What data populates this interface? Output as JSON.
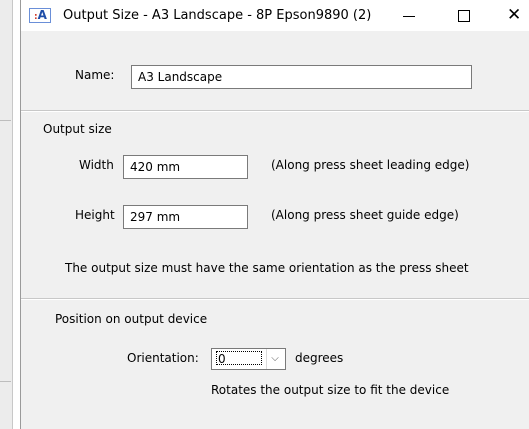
{
  "window": {
    "title": "Output Size - A3 Landscape - 8P Epson9890 (2)",
    "icon_glyph": "A",
    "icon_dots": ":"
  },
  "name_field": {
    "label": "Name:",
    "value": "A3 Landscape"
  },
  "output_size": {
    "section_label": "Output size",
    "width_label": "Width",
    "width_value": "420 mm",
    "width_hint": "(Along press sheet leading edge)",
    "height_label": "Height",
    "height_value": "297 mm",
    "height_hint": "(Along press sheet guide edge)",
    "note": "The output size must have the same orientation as the press sheet"
  },
  "position": {
    "section_label": "Position on output device",
    "orientation_label": "Orientation:",
    "orientation_value": "0",
    "orientation_unit": "degrees",
    "orientation_hint": "Rotates the output size to fit the device"
  },
  "icons": {
    "minimize": "minimize-icon",
    "maximize": "maximize-icon",
    "close": "close-icon",
    "dropdown": "chevron-down-icon"
  }
}
